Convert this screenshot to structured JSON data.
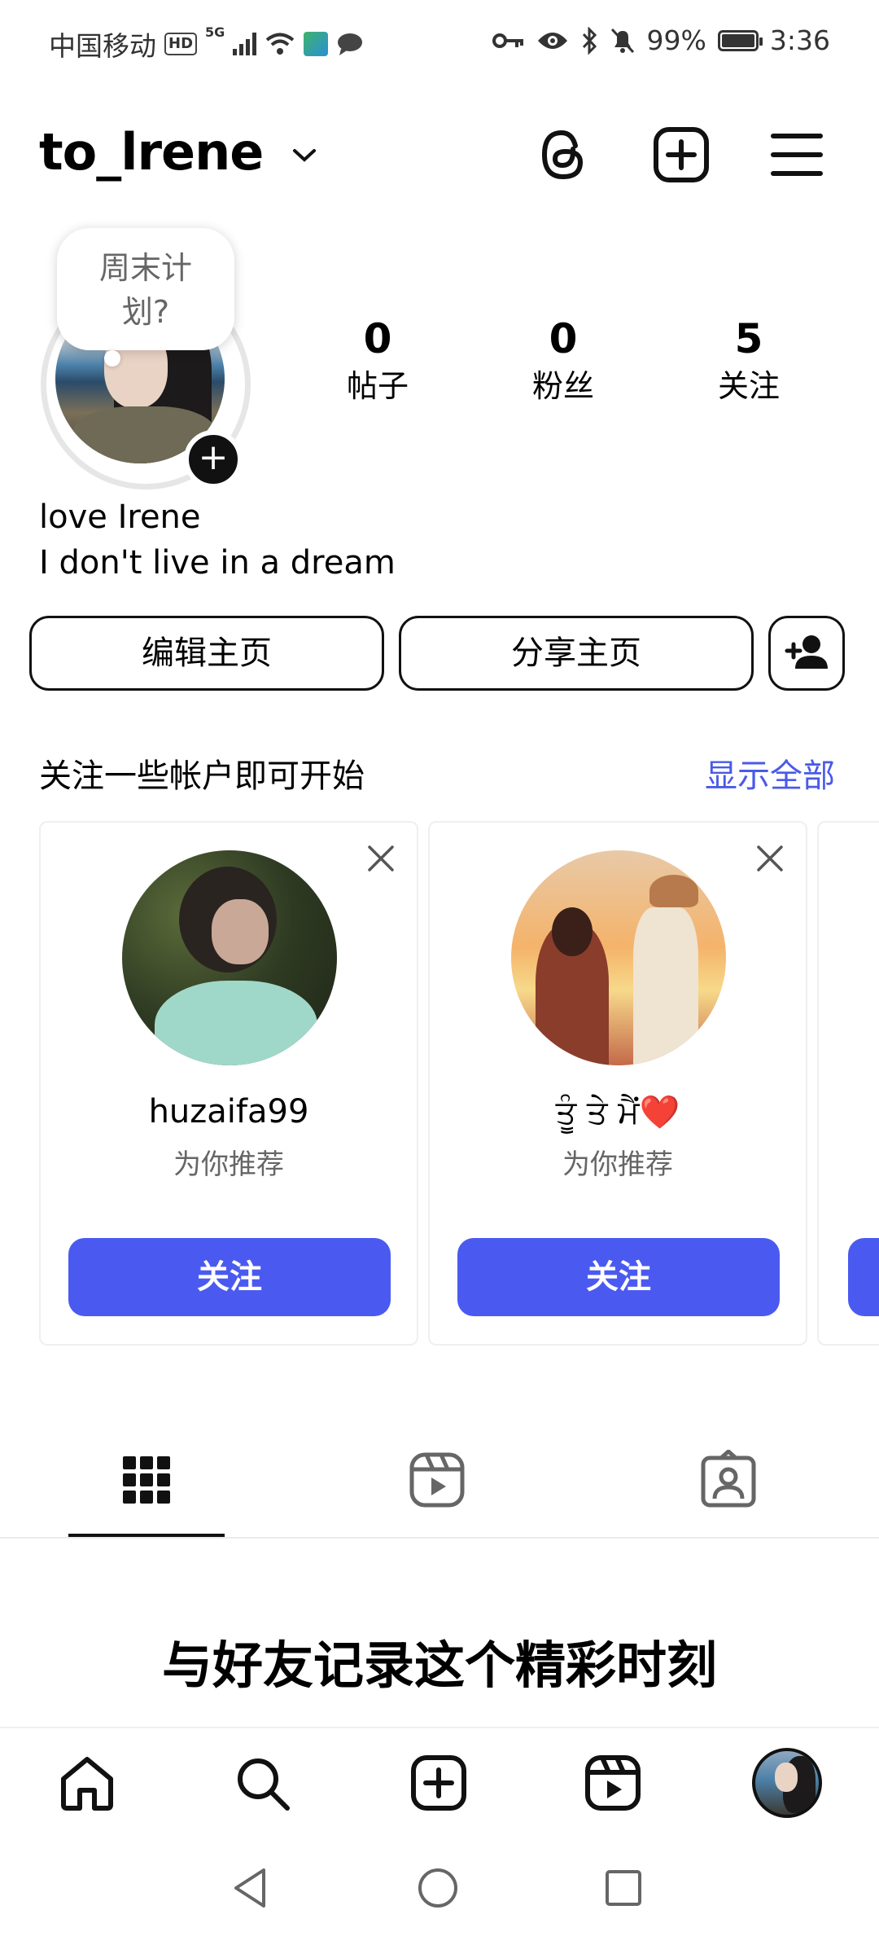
{
  "status_bar": {
    "carrier": "中国移动",
    "hd_badge": "HD",
    "network": "5G",
    "battery": "99%",
    "battery_level": 0.99,
    "time": "3:36"
  },
  "header": {
    "username": "to_lrene",
    "icons": [
      "threads-icon",
      "add-post-icon",
      "menu-icon"
    ]
  },
  "profile": {
    "note_bubble": "周末计划?",
    "stats": [
      {
        "value": "0",
        "label": "帖子"
      },
      {
        "value": "0",
        "label": "粉丝"
      },
      {
        "value": "5",
        "label": "关注"
      }
    ],
    "name": "love Irene",
    "bio": "I don't live in a dream"
  },
  "actions": {
    "edit_profile": "编辑主页",
    "share_profile": "分享主页"
  },
  "suggestions": {
    "title": "关注一些帐户即可开始",
    "show_all": "显示全部",
    "cards": [
      {
        "username": "huzaifa99",
        "subtitle": "为你推荐",
        "follow_label": "关注"
      },
      {
        "username": "ਤੂੰ ਤੇ ਮੈਂ❤️",
        "subtitle": "为你推荐",
        "follow_label": "关注"
      }
    ]
  },
  "content_tabs": [
    "grid-icon",
    "reels-icon",
    "tagged-icon"
  ],
  "empty_state": {
    "heading": "与好友记录这个精彩时刻"
  },
  "bottom_nav": [
    "home-icon",
    "search-icon",
    "create-icon",
    "reels-icon",
    "profile-avatar"
  ],
  "colors": {
    "accent": "#4a5af0",
    "link": "#4a5ae8",
    "text": "#000000",
    "muted": "#666666"
  }
}
